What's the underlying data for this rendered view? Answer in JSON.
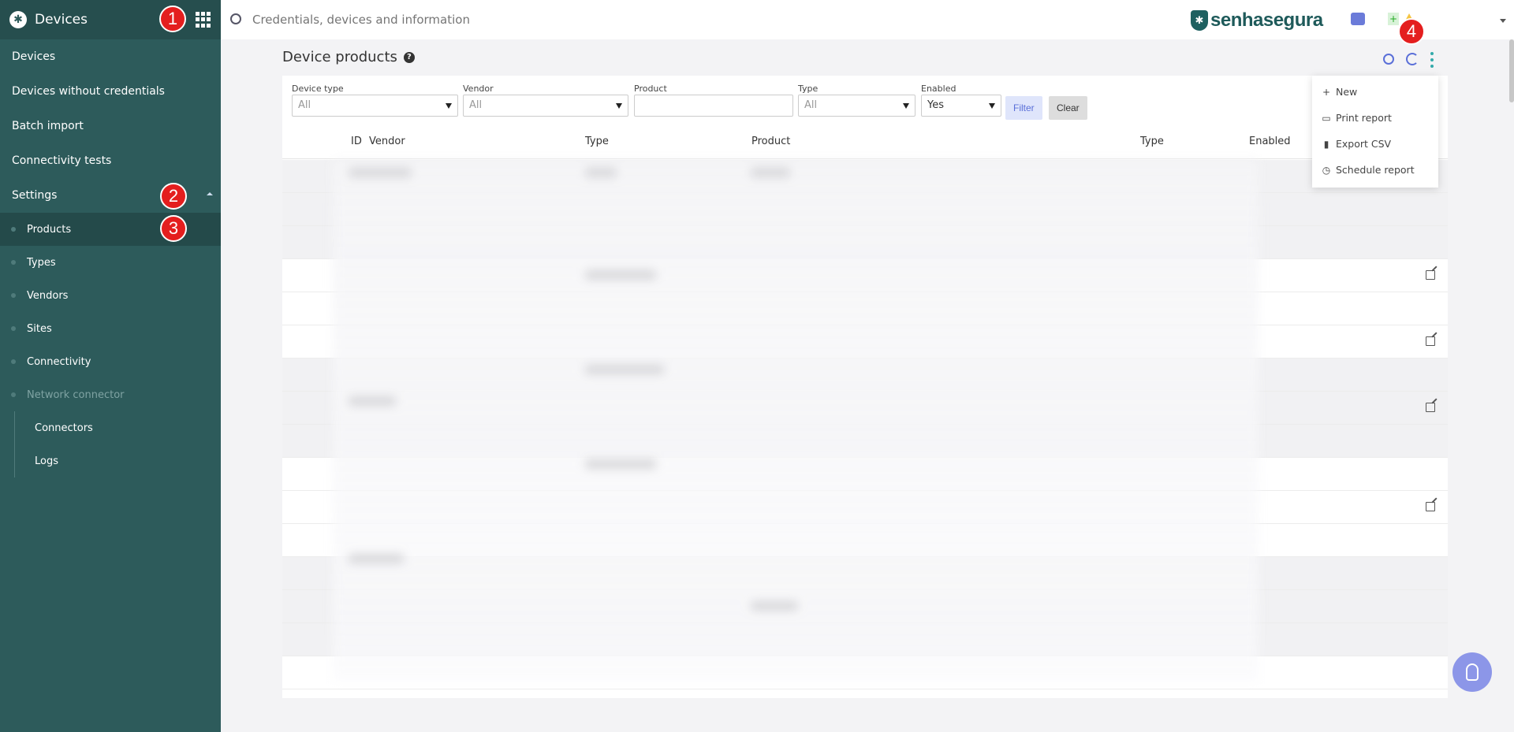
{
  "sidebar": {
    "title": "Devices",
    "items": [
      {
        "label": "Devices"
      },
      {
        "label": "Devices without credentials"
      },
      {
        "label": "Batch import"
      },
      {
        "label": "Connectivity tests"
      },
      {
        "label": "Settings"
      }
    ],
    "settings_sub": [
      {
        "label": "Products"
      },
      {
        "label": "Types"
      },
      {
        "label": "Vendors"
      },
      {
        "label": "Sites"
      },
      {
        "label": "Connectivity"
      },
      {
        "label": "Network connector"
      }
    ],
    "connector_sub": [
      {
        "label": "Connectors"
      },
      {
        "label": "Logs"
      }
    ]
  },
  "topbar": {
    "search_placeholder": "Credentials, devices and information",
    "brand": "senhasegura"
  },
  "badges": [
    "1",
    "2",
    "3",
    "4"
  ],
  "page": {
    "title": "Device products",
    "help": "?"
  },
  "filters": {
    "device_type": {
      "label": "Device type",
      "value": "All"
    },
    "vendor": {
      "label": "Vendor",
      "value": "All"
    },
    "product": {
      "label": "Product",
      "value": ""
    },
    "type": {
      "label": "Type",
      "value": "All"
    },
    "enabled": {
      "label": "Enabled",
      "value": "Yes"
    },
    "filter_btn": "Filter",
    "clear_btn": "Clear"
  },
  "table": {
    "columns": [
      "ID",
      "Vendor",
      "Type",
      "Product",
      "Type",
      "Enabled"
    ]
  },
  "menu": {
    "items": [
      {
        "label": "New",
        "icon": "plus-icon"
      },
      {
        "label": "Print report",
        "icon": "printer-icon"
      },
      {
        "label": "Export CSV",
        "icon": "file-icon"
      },
      {
        "label": "Schedule report",
        "icon": "clock-icon"
      }
    ]
  },
  "colors": {
    "sidebar": "#2d5b5b",
    "accent": "#5a6fd8",
    "badge": "#e41e1e"
  }
}
